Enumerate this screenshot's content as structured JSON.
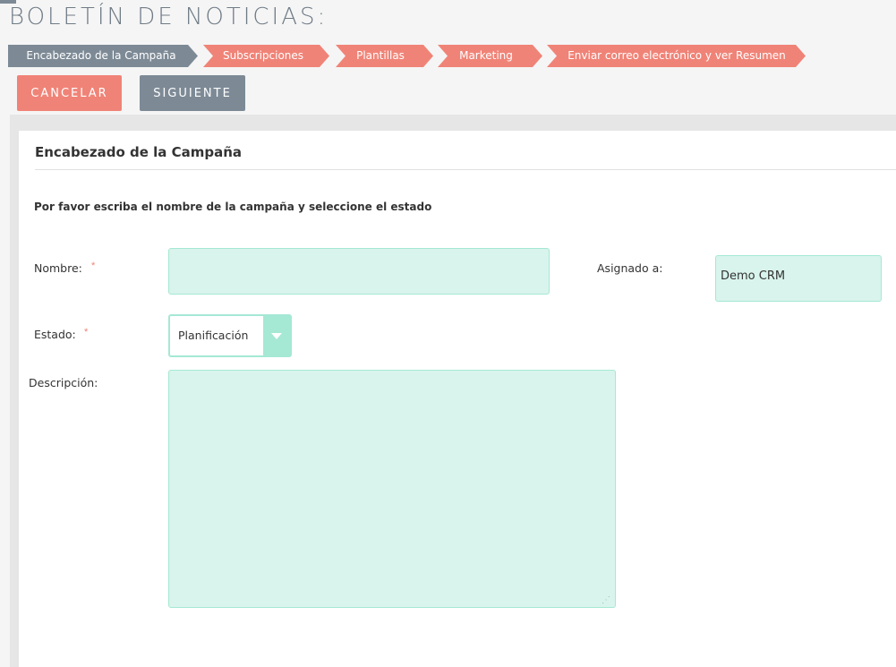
{
  "page": {
    "title": "BOLETÍN DE NOTICIAS:"
  },
  "wizard": {
    "steps": [
      {
        "label": "Encabezado de la Campaña",
        "state": "active"
      },
      {
        "label": "Subscripciones",
        "state": "pending"
      },
      {
        "label": "Plantillas",
        "state": "pending"
      },
      {
        "label": "Marketing",
        "state": "pending"
      },
      {
        "label": "Enviar correo electrónico y ver Resumen",
        "state": "pending"
      }
    ]
  },
  "actions": {
    "cancel_label": "CANCELAR",
    "next_label": "SIGUIENTE"
  },
  "form": {
    "section_title": "Encabezado de la Campaña",
    "hint": "Por favor escriba el nombre de la campaña y seleccione el estado",
    "required_marker": "*",
    "name": {
      "label": "Nombre:",
      "value": ""
    },
    "assigned": {
      "label": "Asignado a:",
      "value": "Demo CRM"
    },
    "status": {
      "label": "Estado:",
      "value": "Planificación"
    },
    "description": {
      "label": "Descripción:",
      "value": ""
    }
  },
  "colors": {
    "active_step": "#7d8a96",
    "pending_step": "#f08377",
    "field_fill": "#d9f4ec",
    "field_border": "#a5e8d4"
  },
  "icons": {
    "dropdown": "chevron-down-icon",
    "resize": "resize-grip-icon"
  }
}
